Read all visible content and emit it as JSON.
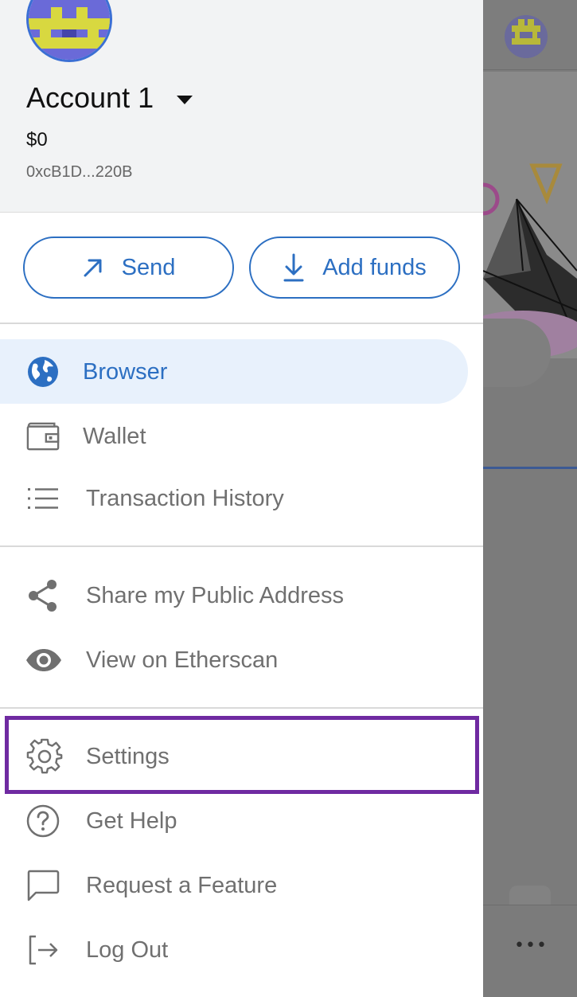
{
  "account": {
    "name": "Account 1",
    "balance": "$0",
    "address": "0xcB1D...220B"
  },
  "actions": {
    "send_label": "Send",
    "add_funds_label": "Add funds"
  },
  "nav": {
    "primary": [
      {
        "label": "Browser",
        "icon": "globe-icon",
        "active": true
      },
      {
        "label": "Wallet",
        "icon": "wallet-icon",
        "active": false
      },
      {
        "label": "Transaction History",
        "icon": "list-icon",
        "active": false
      }
    ],
    "secondary": [
      {
        "label": "Share my Public Address",
        "icon": "share-icon"
      },
      {
        "label": "View on Etherscan",
        "icon": "eye-icon"
      }
    ],
    "tertiary": [
      {
        "label": "Settings",
        "icon": "gear-icon",
        "highlighted": true
      },
      {
        "label": "Get Help",
        "icon": "help-icon"
      },
      {
        "label": "Request a Feature",
        "icon": "chat-bubble-icon"
      },
      {
        "label": "Log Out",
        "icon": "logout-icon"
      }
    ]
  },
  "background": {
    "overflow_menu": "•••"
  },
  "colors": {
    "accent": "#2c6fc2",
    "active_bg": "#e8f1fc",
    "highlight_border": "#6f2aa1",
    "muted_text": "#707070"
  }
}
